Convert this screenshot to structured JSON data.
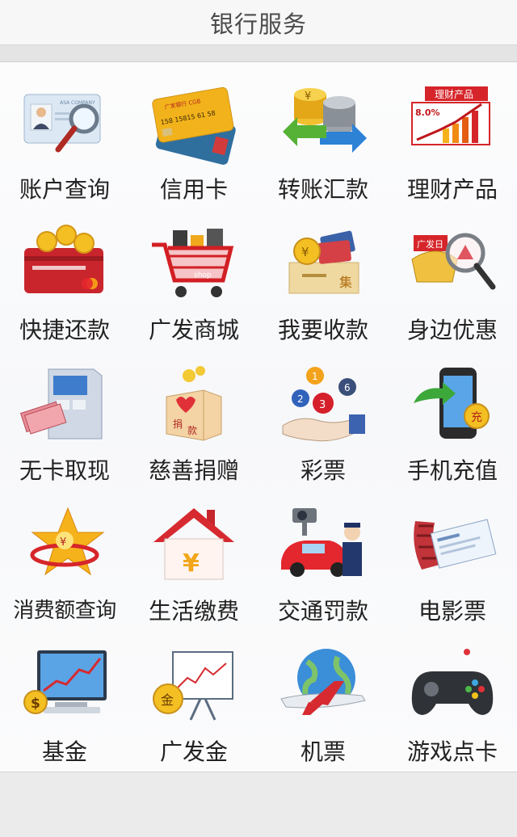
{
  "header": {
    "title": "银行服务"
  },
  "grid": {
    "items": [
      {
        "label": "账户查询",
        "icon": "account-query-icon",
        "card_text": "ASA COMPANY"
      },
      {
        "label": "信用卡",
        "icon": "credit-card-icon",
        "card_text": "广发银行 CGB",
        "card_number": "158 15815 61 58"
      },
      {
        "label": "转账汇款",
        "icon": "transfer-icon",
        "symbol": "¥"
      },
      {
        "label": "理财产品",
        "icon": "wealth-products-icon",
        "sign_text": "理财产品",
        "percent": "8.0%"
      },
      {
        "label": "快捷还款",
        "icon": "quick-repay-icon"
      },
      {
        "label": "广发商城",
        "icon": "shopping-cart-icon",
        "cart_text": "shop"
      },
      {
        "label": "我要收款",
        "icon": "receive-payment-icon",
        "symbol": "¥",
        "box_text": "集"
      },
      {
        "label": "身边优惠",
        "icon": "nearby-deals-icon",
        "tag_text": "广发日"
      },
      {
        "label": "无卡取现",
        "icon": "atm-icon"
      },
      {
        "label": "慈善捐赠",
        "icon": "donation-box-icon",
        "box_text_1": "捐",
        "box_text_2": "款"
      },
      {
        "label": "彩票",
        "icon": "lottery-icon",
        "balls": [
          "1",
          "2",
          "3",
          "6"
        ]
      },
      {
        "label": "手机充值",
        "icon": "mobile-recharge-icon",
        "coin_text": "充"
      },
      {
        "label": "消费额查询",
        "icon": "spending-query-icon",
        "coin_text": "¥"
      },
      {
        "label": "生活缴费",
        "icon": "utility-payment-icon",
        "symbol": "¥"
      },
      {
        "label": "交通罚款",
        "icon": "traffic-fine-icon"
      },
      {
        "label": "电影票",
        "icon": "movie-ticket-icon"
      },
      {
        "label": "基金",
        "icon": "fund-icon",
        "symbol": "$"
      },
      {
        "label": "广发金",
        "icon": "gold-icon",
        "coin_text": "金"
      },
      {
        "label": "机票",
        "icon": "flight-ticket-icon"
      },
      {
        "label": "游戏点卡",
        "icon": "game-card-icon"
      }
    ]
  }
}
